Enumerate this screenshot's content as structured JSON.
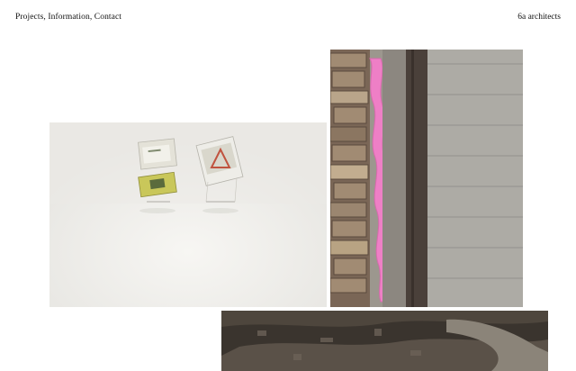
{
  "header": {
    "nav": [
      {
        "label": "Projects"
      },
      {
        "label": "Information"
      },
      {
        "label": "Contact"
      }
    ],
    "separator": ", ",
    "brand": "6a architects"
  },
  "gallery": {
    "images": [
      {
        "subject": "white room with two suspended transparent boxes holding cards"
      },
      {
        "subject": "brick wall with pink expanding foam beside concrete board-marked wall"
      },
      {
        "subject": "excavated site with soil and concrete edge"
      }
    ]
  },
  "colors": {
    "text": "#111111",
    "background": "#ffffff",
    "foam_pink": "#ee7fc6"
  }
}
